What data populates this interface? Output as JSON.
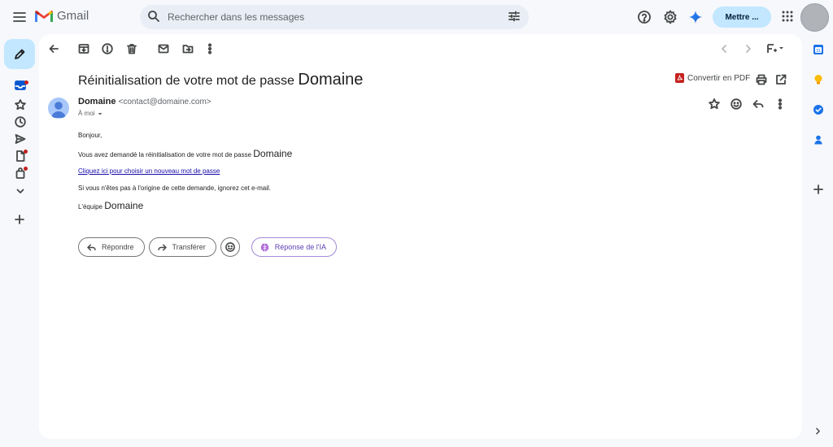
{
  "app": {
    "name": "Gmail"
  },
  "search": {
    "placeholder": "Rechercher dans les messages"
  },
  "header": {
    "upgrade_label": "Mettre ..."
  },
  "colors": {
    "accent": "#c2e7ff",
    "link": "#1a0dab",
    "badge": "#c5221f",
    "ai": "#5b3fb3"
  },
  "rail": {
    "items": [
      {
        "icon": "inbox-icon",
        "badge": true
      },
      {
        "icon": "star-icon",
        "badge": false
      },
      {
        "icon": "clock-icon",
        "badge": false
      },
      {
        "icon": "send-icon",
        "badge": false
      },
      {
        "icon": "draft-icon",
        "badge": true
      },
      {
        "icon": "bag-icon",
        "badge": true
      },
      {
        "icon": "chevron-down-icon",
        "badge": false
      }
    ]
  },
  "email": {
    "subject": "Réinitialisation de votre mot de passe",
    "subject_brand": "Domaine",
    "convert_pdf": "Convertir en PDF",
    "sender_name": "Domaine",
    "sender_email": "<contact@domaine.com>",
    "recipient": "À moi",
    "body": {
      "greeting": "Bonjour,",
      "line1": "Vous avez demandé la réinitialisation de votre mot de passe",
      "line1_brand": "Domaine",
      "link": "Cliquez ici pour choisir un nouveau mot de passe",
      "line2": "Si vous n'êtes pas à l'origine de cette demande, ignorez cet e-mail.",
      "signoff": "L'équipe",
      "signoff_brand": "Domaine"
    }
  },
  "actions": {
    "reply": "Répondre",
    "forward": "Transférer",
    "ai_reply": "Réponse de l'IA"
  }
}
